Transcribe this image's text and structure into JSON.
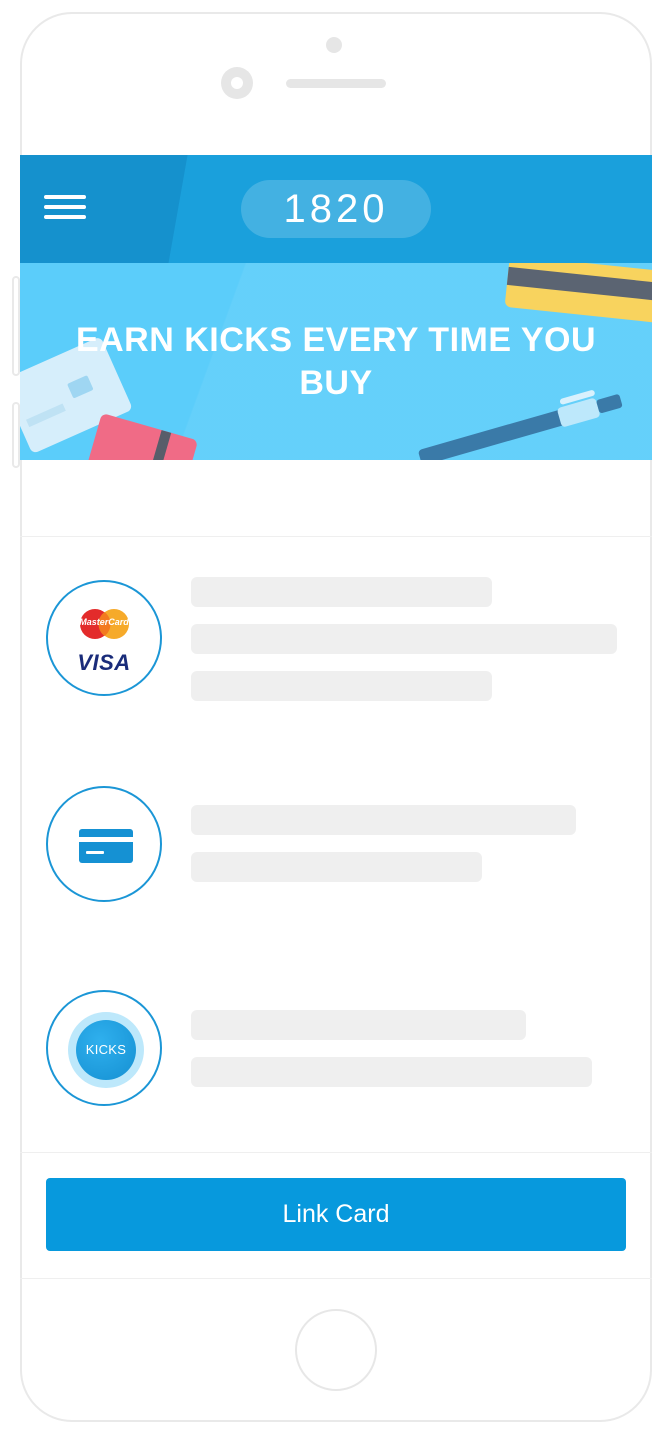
{
  "header": {
    "score": "1820"
  },
  "banner": {
    "title": "EARN KICKS EVERY TIME YOU BUY"
  },
  "options": [
    {
      "icon": "mastercard-visa-logos",
      "mastercard_label": "MasterCard",
      "visa_label": "VISA"
    },
    {
      "icon": "credit-card-icon"
    },
    {
      "icon": "kicks-coin-icon",
      "kicks_label": "KICKS"
    }
  ],
  "actions": {
    "link_card_label": "Link Card"
  },
  "colors": {
    "header_blue": "#1aa0dc",
    "banner_blue": "#5bcdfa",
    "button_blue": "#0799dd",
    "skeleton_gray": "#efefef"
  }
}
